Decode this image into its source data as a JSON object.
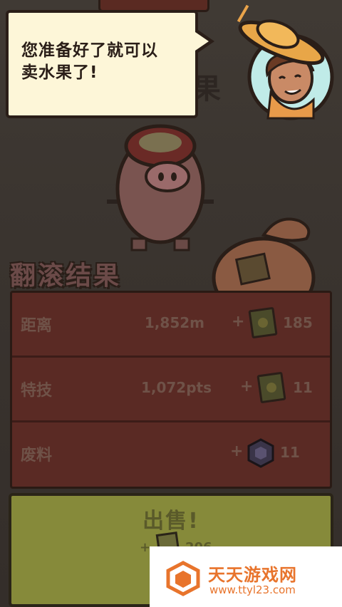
{
  "dialog": {
    "message_line1": "您准备好了就可以",
    "message_line2": "卖水果了!"
  },
  "background": {
    "sign_text": "果"
  },
  "results": {
    "title": "翻滚结果",
    "rows": [
      {
        "label": "距离",
        "value": "1,852m",
        "plus": "+",
        "reward": "185",
        "reward_icon": "coin-card-icon"
      },
      {
        "label": "特技",
        "value": "1,072pts",
        "plus": "+",
        "reward": "11",
        "reward_icon": "coin-card-icon"
      },
      {
        "label": "废料",
        "value": "",
        "plus": "+",
        "reward": "11",
        "reward_icon": "hex-scrap-icon"
      }
    ]
  },
  "sell_button": {
    "label": "出售!",
    "plus": "+",
    "amount": "206"
  },
  "watermark": {
    "title": "天天游戏网",
    "url": "www.ttyl23.com"
  },
  "colors": {
    "panel": "#5a2a24",
    "sell": "#868a3a",
    "dialog": "#fdf6d8",
    "watermark": "#e8742c"
  }
}
